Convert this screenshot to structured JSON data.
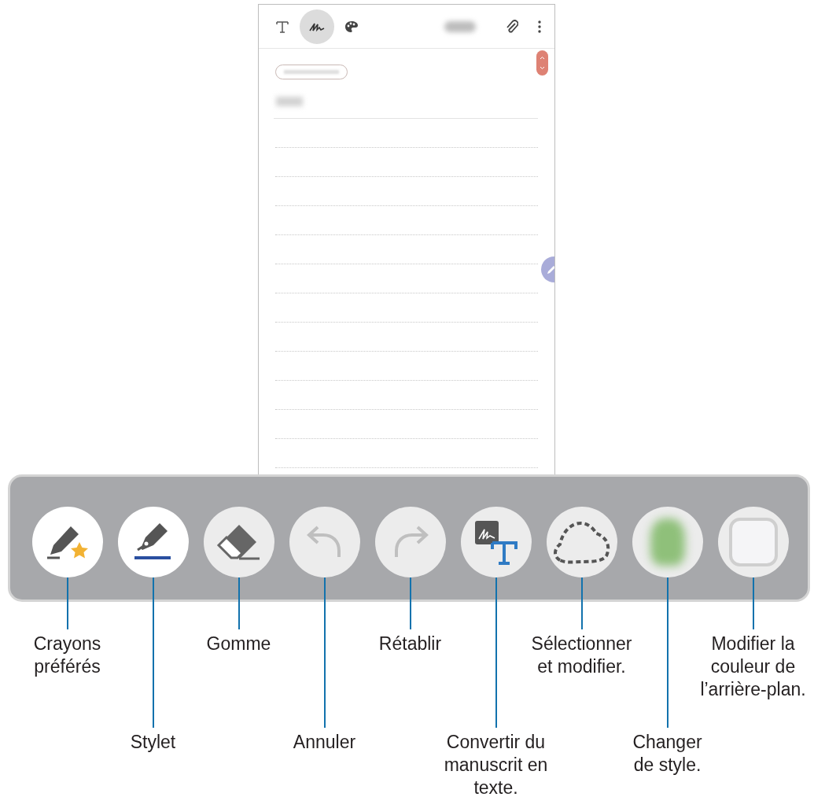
{
  "note_editor": {
    "toolbar": [
      {
        "kind": "text",
        "selected": false
      },
      {
        "kind": "handwriting",
        "selected": true
      },
      {
        "kind": "palette",
        "selected": false
      },
      {
        "kind": "blurred"
      },
      {
        "kind": "attach"
      },
      {
        "kind": "more"
      }
    ]
  },
  "pen_toolbar": [
    {
      "kind": "favorite-pens",
      "active": true,
      "disabled": false,
      "label": "Crayons\npréférés"
    },
    {
      "kind": "stylus",
      "active": true,
      "disabled": false,
      "label": "Stylet"
    },
    {
      "kind": "eraser",
      "active": false,
      "disabled": false,
      "label": "Gomme"
    },
    {
      "kind": "undo",
      "active": false,
      "disabled": true,
      "label": "Annuler"
    },
    {
      "kind": "redo",
      "active": false,
      "disabled": true,
      "label": "Rétablir"
    },
    {
      "kind": "convert",
      "active": false,
      "disabled": false,
      "label": "Convertir du\nmanuscrit en\ntexte."
    },
    {
      "kind": "select",
      "active": false,
      "disabled": false,
      "label": "Sélectionner\net modifier."
    },
    {
      "kind": "style",
      "active": false,
      "disabled": false,
      "label": "Changer\nde style."
    },
    {
      "kind": "background",
      "active": false,
      "disabled": false,
      "label": "Modifier la\ncouleur de\nl’arrière-plan."
    }
  ]
}
